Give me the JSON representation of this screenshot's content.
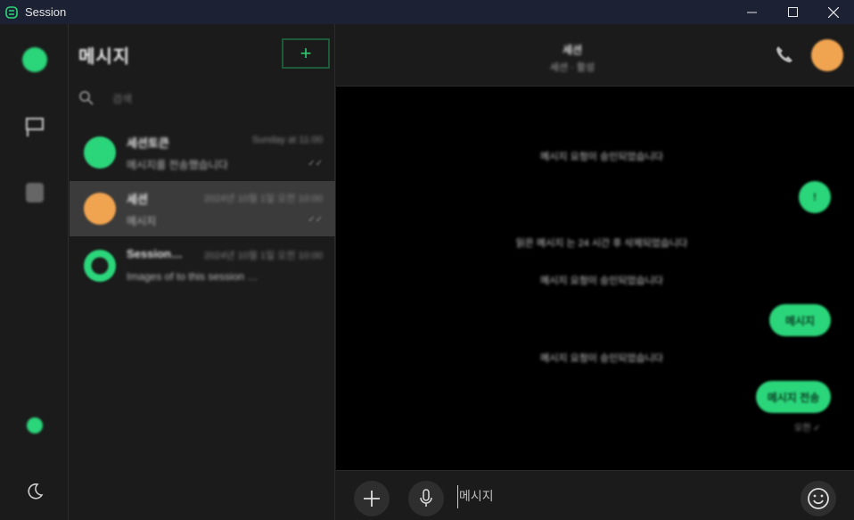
{
  "app": {
    "title": "Session"
  },
  "colors": {
    "accent": "#2bd67b",
    "titlebar": "#1c2133",
    "orange": "#f1a450"
  },
  "rail": {
    "items": [
      {
        "icon": "profile-avatar-icon"
      },
      {
        "icon": "message-requests-icon"
      },
      {
        "icon": "settings-icon"
      },
      {
        "icon": "online-status-icon"
      },
      {
        "icon": "theme-moon-icon"
      }
    ]
  },
  "list": {
    "title": "메시지",
    "search_label": "검색",
    "compose_symbol": "+",
    "conversations": [
      {
        "name": "세션토큰",
        "time": "Sunday at 11:00",
        "preview": "메시지를 전송했습니다",
        "status": "✓✓",
        "avatar_color": "#2bd67b",
        "selected": false
      },
      {
        "name": "세션",
        "time": "2024년 10월 1일 오전 10:00",
        "preview": "메시지",
        "status": "✓✓",
        "avatar_color": "#f1a450",
        "selected": true
      },
      {
        "name": "Session…",
        "time": "2024년 10월 1일 오전 10:00",
        "preview": "Images of to this session …",
        "status": "",
        "avatar_color": "#2bd67b",
        "selected": false
      }
    ]
  },
  "chat": {
    "name": "세션",
    "subtitle": "세션 · 활성",
    "notices": [
      "메시지 요청이 승인되었습니다",
      "읽은 메시지 는 24 시간 후 삭제되었습니다",
      "메시지 요청이 승인되었습니다",
      "메시지 요청이 승인되었습니다"
    ],
    "bubbles": [
      {
        "text": "!"
      },
      {
        "text": "메시지"
      },
      {
        "text": "메시지 전송"
      }
    ],
    "last_meta": "오전 ✓",
    "input_placeholder": "메시지"
  }
}
